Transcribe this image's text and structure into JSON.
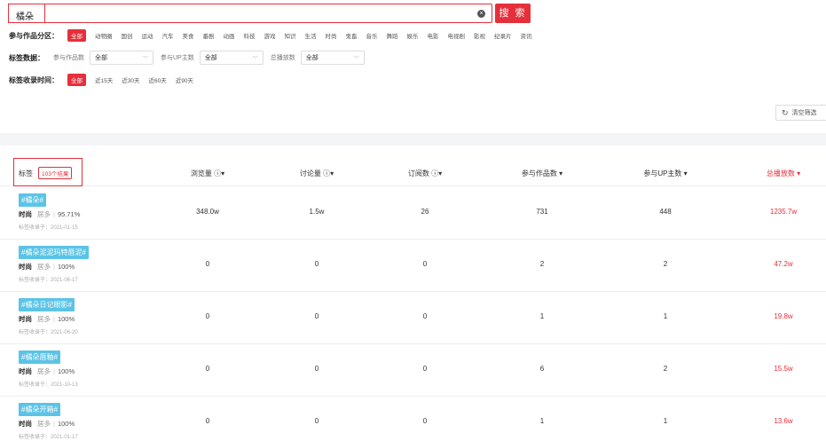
{
  "search": {
    "query": "橘朵",
    "clear_icon": "×",
    "button_label": "搜 索",
    "accent_color": "#e5303c"
  },
  "filters": {
    "category_label": "参与作品分区：",
    "categories": [
      "全部",
      "动物圈",
      "国创",
      "运动",
      "汽车",
      "美食",
      "番剧",
      "动画",
      "科技",
      "游戏",
      "知识",
      "生活",
      "时尚",
      "鬼畜",
      "音乐",
      "舞蹈",
      "娱乐",
      "电影",
      "电视剧",
      "影视",
      "纪录片",
      "资讯"
    ],
    "data_label": "标签数据：",
    "works_label": "参与作品数",
    "works_value": "全部",
    "up_label": "参与UP主数",
    "up_value": "全部",
    "plays_label": "总播放数",
    "plays_value": "全部",
    "time_label": "标签收录时间：",
    "times": [
      "全部",
      "近15天",
      "近30天",
      "近60天",
      "近90天"
    ],
    "clear_label": "清空筛选"
  },
  "table": {
    "tag_header": "标签",
    "result_badge": "103个结果",
    "headers": [
      "浏览量 ⓘ▾",
      "讨论量 ⓘ▾",
      "订阅数 ⓘ▾",
      "参与作品数 ▾",
      "参与UP主数 ▾",
      "总播放数 ▾"
    ],
    "rows": [
      {
        "tag": "#橘朵#",
        "category": "时尚",
        "most_label": "居多",
        "pct": "95.71%",
        "date": "标签收录于：2021-01-15",
        "views": "348.0w",
        "discussions": "1.5w",
        "subs": "26",
        "works": "731",
        "ups": "448",
        "plays": "1235.7w"
      },
      {
        "tag": "#橘朵泥泥玛特唇泥#",
        "category": "时尚",
        "most_label": "居多",
        "pct": "100%",
        "date": "标签收录于：2021-06-17",
        "views": "0",
        "discussions": "0",
        "subs": "0",
        "works": "2",
        "ups": "2",
        "plays": "47.2w"
      },
      {
        "tag": "#橘朵日记眼影#",
        "category": "时尚",
        "most_label": "居多",
        "pct": "100%",
        "date": "标签收录于：2021-06-20",
        "views": "0",
        "discussions": "0",
        "subs": "0",
        "works": "1",
        "ups": "1",
        "plays": "19.8w"
      },
      {
        "tag": "#橘朵唇釉#",
        "category": "时尚",
        "most_label": "居多",
        "pct": "100%",
        "date": "标签收录于：2021-10-13",
        "views": "0",
        "discussions": "0",
        "subs": "0",
        "works": "6",
        "ups": "2",
        "plays": "15.5w"
      },
      {
        "tag": "#橘朵开箱#",
        "category": "时尚",
        "most_label": "居多",
        "pct": "100%",
        "date": "标签收录于：2021-01-17",
        "views": "0",
        "discussions": "0",
        "subs": "0",
        "works": "1",
        "ups": "1",
        "plays": "13.6w"
      }
    ]
  }
}
